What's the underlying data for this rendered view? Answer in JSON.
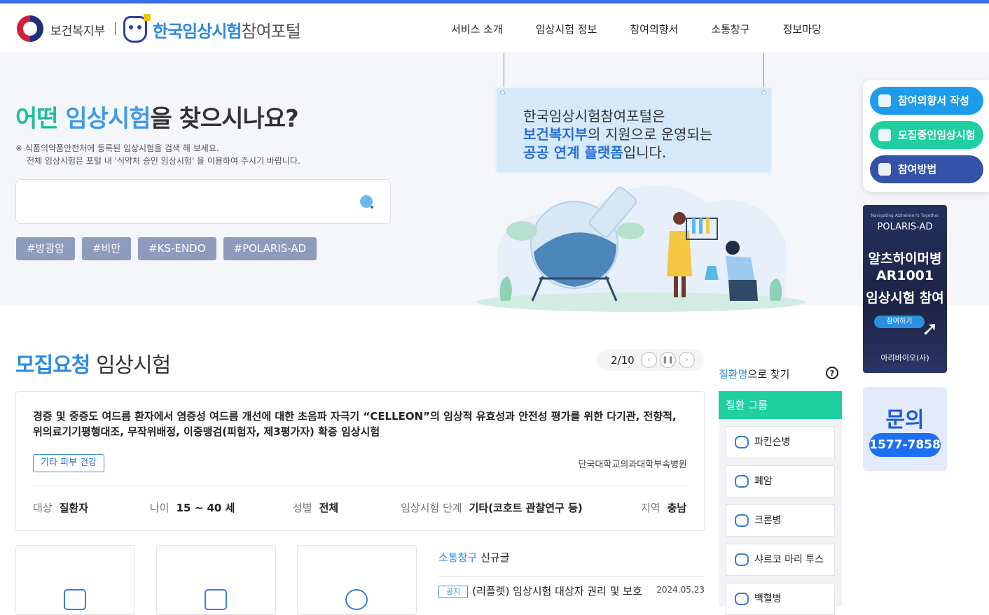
{
  "header": {
    "ministry": "보건복지부",
    "portal_bold": "한국임상시험",
    "portal_light": "참여포털",
    "nav": [
      "서비스 소개",
      "임상시험 정보",
      "참여의향서",
      "소통창구",
      "정보마당"
    ]
  },
  "hero": {
    "title_part1": "어떤",
    "title_part2": "임상시험",
    "title_part3": "을 찾으시나요?",
    "note1": "※  식품의약품안전처에 등록된 임상시험을 검색 해 보세요.",
    "note2": "전체 임상시험은 포털 내 '식약처 승인 임상시험' 을 이용하여 주시기 바랍니다.",
    "search_placeholder": "",
    "tags": [
      "#방광암",
      "#비만",
      "#KS-ENDO",
      "#POLARIS-AD"
    ],
    "board_line1": "한국임상시험참여포털은",
    "board_line2_b": "보건복지부",
    "board_line2": "의 지원으로 운영되는",
    "board_line3_b": "공공 연계 플랫폼",
    "board_line3": "입니다."
  },
  "side": {
    "buttons": [
      "참여의향서 작성",
      "모집중인임상시험",
      "참여방법"
    ],
    "colors": [
      "#1e9bea",
      "#1fcf9f",
      "#3352a8"
    ],
    "banner_sub": "Navigating Alzheimer's Together",
    "banner_logo": "POLARIS-AD",
    "banner_l1": "알츠하이머병",
    "banner_l2": "AR1001",
    "banner_l3": "임상시험 참여",
    "banner_btn": "참여하기",
    "banner_company": "아리바이오(사)",
    "contact_title": "문의",
    "contact_phone": "1577-7858"
  },
  "recruit": {
    "title_b": "모집요청",
    "title": "임상시험",
    "page": "2/10",
    "card": {
      "title": "경증 및 중증도 여드름 환자에서 염증성 여드름 개선에 대한 초음파 자극기 “CELLEON”의 임상적 유효성과 안전성 평가를 위한 다기관, 전향적, 위의료기기평행대조, 무작위배정, 이중맹검(피험자, 제3평가자) 확증 임상시험",
      "category": "기타 피부 건강",
      "institution": "단국대학교의과대학부속병원",
      "target_k": "대상",
      "target_v": "질환자",
      "age_k": "나이",
      "age_v": "15 ~ 40 세",
      "sex_k": "성별",
      "sex_v": "전체",
      "phase_k": "임상시험 단계",
      "phase_v": "기타(코호트 관찰연구 등)",
      "region_k": "지역",
      "region_v": "충남"
    }
  },
  "notice": {
    "head_b": "소통창구",
    "head": "신규글",
    "badge": "공지",
    "text": "(리플렛) 임상시험 대상자 권리 및 보호",
    "date": "2024.05.23"
  },
  "disease": {
    "head_b": "질환명",
    "head": "으로 찾기",
    "help": "?",
    "group": "질환 그룹",
    "items": [
      "파킨슨병",
      "폐암",
      "크론병",
      "샤르코 마리 투스",
      "백혈병"
    ]
  }
}
